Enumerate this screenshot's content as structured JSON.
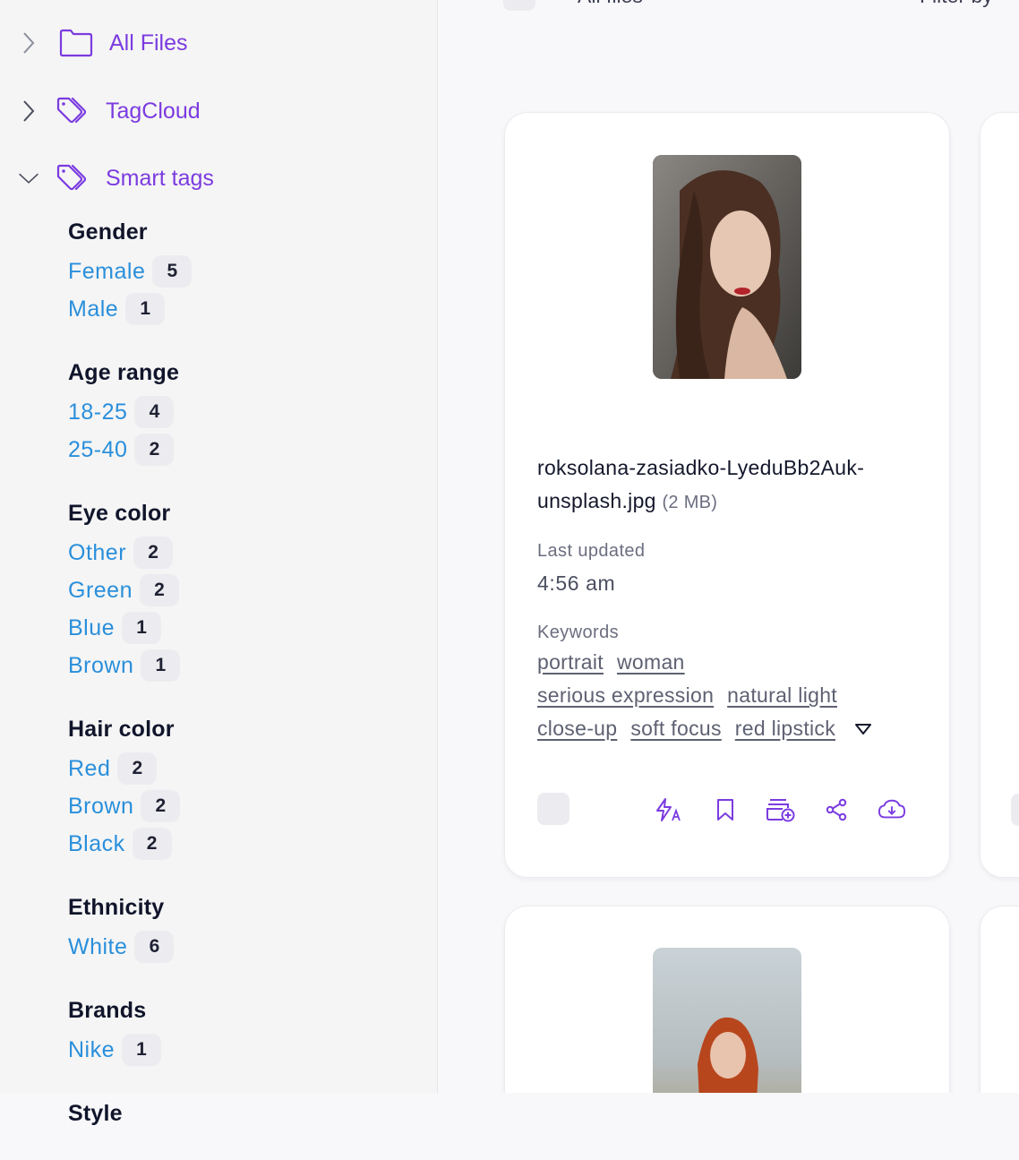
{
  "nav": {
    "all_files": "All Files",
    "tagcloud": "TagCloud",
    "smart_tags": "Smart tags"
  },
  "facets": [
    {
      "title": "Gender",
      "items": [
        {
          "name": "Female",
          "count": "5"
        },
        {
          "name": "Male",
          "count": "1"
        }
      ]
    },
    {
      "title": "Age range",
      "items": [
        {
          "name": "18-25",
          "count": "4"
        },
        {
          "name": "25-40",
          "count": "2"
        }
      ]
    },
    {
      "title": "Eye color",
      "items": [
        {
          "name": "Other",
          "count": "2"
        },
        {
          "name": "Green",
          "count": "2"
        },
        {
          "name": "Blue",
          "count": "1"
        },
        {
          "name": "Brown",
          "count": "1"
        }
      ]
    },
    {
      "title": "Hair color",
      "items": [
        {
          "name": "Red",
          "count": "2"
        },
        {
          "name": "Brown",
          "count": "2"
        },
        {
          "name": "Black",
          "count": "2"
        }
      ]
    },
    {
      "title": "Ethnicity",
      "items": [
        {
          "name": "White",
          "count": "6"
        }
      ]
    },
    {
      "title": "Brands",
      "items": [
        {
          "name": "Nike",
          "count": "1"
        }
      ]
    },
    {
      "title": "Style",
      "items": []
    }
  ],
  "topbar": {
    "all_files": "All files",
    "filter_by": "Filter by"
  },
  "card1": {
    "filename": "roksolana-zasiadko-LyeduBb2Auk-unsplash.jpg",
    "size": "(2 MB)",
    "last_updated_label": "Last updated",
    "last_updated": "4:56 am",
    "keywords_label": "Keywords",
    "keywords": [
      "portrait",
      "woman",
      "serious expression",
      "natural light",
      "close-up",
      "soft focus",
      "red lipstick"
    ]
  },
  "icons": {
    "translate": "auto-tag-icon",
    "bookmark": "bookmark-icon",
    "add_to_collection": "add-to-folder-icon",
    "share": "share-icon",
    "download": "cloud-download-icon"
  },
  "colors": {
    "accent": "#7b3be0",
    "tag_link": "#2a8fdb"
  }
}
